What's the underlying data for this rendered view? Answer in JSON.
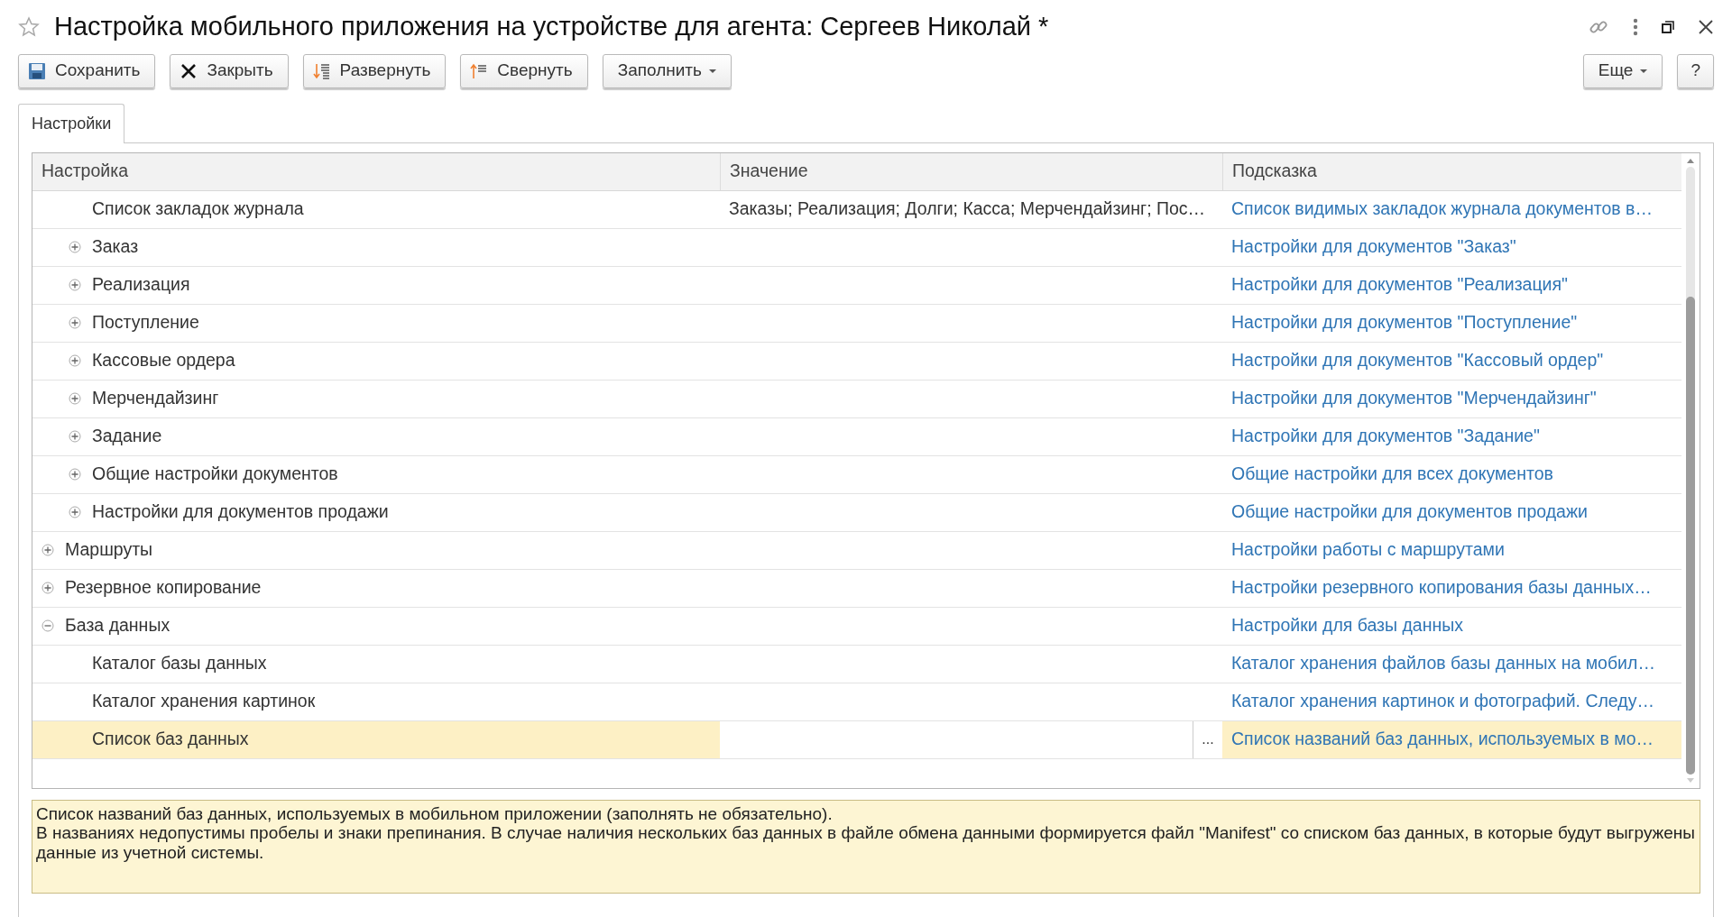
{
  "window": {
    "title": "Настройка мобильного приложения на устройстве для агента: Сергеев Николай *"
  },
  "toolbar": {
    "buttons": [
      {
        "kind": "save",
        "label": "Сохранить"
      },
      {
        "kind": "close",
        "label": "Закрыть"
      },
      {
        "kind": "expand",
        "label": "Развернуть"
      },
      {
        "kind": "collapse",
        "label": "Свернуть"
      },
      {
        "kind": "menu",
        "label": "Заполнить"
      }
    ],
    "right_buttons": [
      {
        "kind": "menu",
        "label": "Еще"
      },
      {
        "kind": "plain",
        "label": "?"
      }
    ]
  },
  "tabs": [
    {
      "label": "Настройки",
      "selected": true
    }
  ],
  "table": {
    "columns": [
      "Настройка",
      "Значение",
      "Подсказка"
    ],
    "scrolled_group_rows": [
      {
        "label": "Список закладок журнала",
        "value": "Заказы; Реализация; Долги; Касса; Мерчендайзинг; Пос…",
        "hint": "Список видимых закладок журнала документов в…",
        "selected": false
      },
      {
        "label": "Заказ",
        "hint": "Настройки для документов \"Заказ\"",
        "expanded": false,
        "selected": false
      },
      {
        "label": "Реализация",
        "hint": "Настройки для документов \"Реализация\"",
        "expanded": false,
        "selected": false
      },
      {
        "label": "Поступление",
        "hint": "Настройки для документов \"Поступление\"",
        "expanded": false,
        "selected": false
      },
      {
        "label": "Кассовые ордера",
        "hint": "Настройки для документов \"Кассовый ордер\"",
        "expanded": false,
        "selected": false
      },
      {
        "label": "Мерчендайзинг",
        "hint": "Настройки для документов \"Мерчендайзинг\"",
        "expanded": false,
        "selected": false
      },
      {
        "label": "Задание",
        "hint": "Настройки для документов \"Задание\"",
        "expanded": false,
        "selected": false
      },
      {
        "label": "Общие настройки документов",
        "hint": "Общие настройки для всех документов",
        "expanded": false,
        "selected": false
      },
      {
        "label": "Настройки для документов продажи",
        "hint": "Общие настройки для документов продажи",
        "expanded": false,
        "selected": false
      }
    ],
    "rows": [
      {
        "label": "Маршруты",
        "hint": "Настройки работы с маршрутами",
        "expanded": false,
        "selected": false
      },
      {
        "label": "Резервное копирование",
        "hint": "Настройки резервного копирования базы данных…",
        "expanded": false,
        "selected": false
      },
      {
        "label": "База данных",
        "hint": "Настройки для базы данных",
        "expanded": true,
        "selected": false,
        "children": [
          {
            "label": "Каталог базы данных",
            "hint": "Каталог хранения файлов базы данных на мобил…",
            "selected": false
          },
          {
            "label": "Каталог хранения картинок",
            "hint": "Каталог хранения картинок и фотографий. Следу…",
            "selected": false
          },
          {
            "label": "Список баз данных",
            "hint": "Список названий баз данных, используемых в мо…",
            "selected": true,
            "editing": true,
            "choice_button": "..."
          }
        ]
      }
    ]
  },
  "note": {
    "lines": [
      "Список названий баз данных, используемых в мобильном приложении (заполнять не обязательно).",
      "В названиях недопустимы пробелы и знаки препинания. В случае наличия нескольких баз данных в файле обмена данными формируется файл \"Manifest\" со списком баз данных, в которые будут выгружены данные из учетной системы."
    ]
  }
}
